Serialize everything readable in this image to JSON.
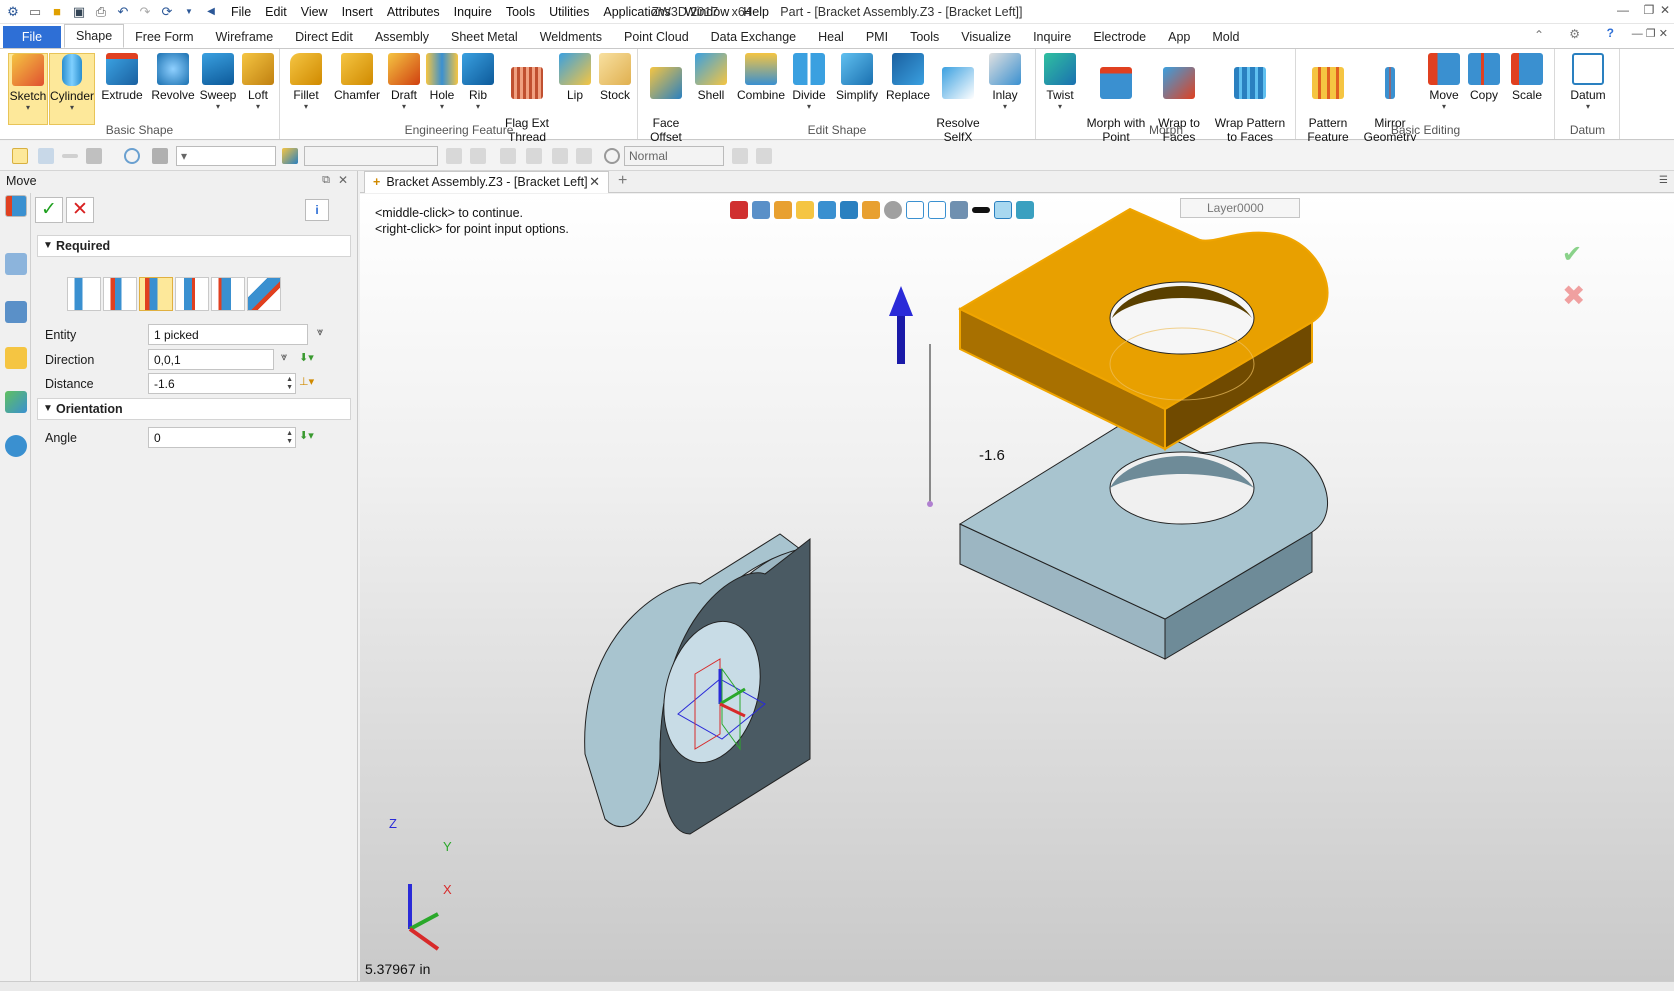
{
  "window": {
    "app_title": "ZW3D 2017",
    "arch": "x64",
    "doc_title": "Part - [Bracket Assembly.Z3 - [Bracket Left]]"
  },
  "menu": [
    "File",
    "Edit",
    "View",
    "Insert",
    "Attributes",
    "Inquire",
    "Tools",
    "Utilities",
    "Applications",
    "Window",
    "Help"
  ],
  "ribbon_tabs": [
    "File",
    "Shape",
    "Free Form",
    "Wireframe",
    "Direct Edit",
    "Assembly",
    "Sheet Metal",
    "Weldments",
    "Point Cloud",
    "Data Exchange",
    "Heal",
    "PMI",
    "Tools",
    "Visualize",
    "Inquire",
    "Electrode",
    "App",
    "Mold"
  ],
  "active_tab": "Shape",
  "ribbon": {
    "basic_shape": {
      "label": "Basic Shape",
      "buttons": [
        "Sketch",
        "Cylinder",
        "Extrude",
        "Revolve",
        "Sweep",
        "Loft"
      ]
    },
    "engineering_feature": {
      "label": "Engineering Feature",
      "buttons": [
        "Fillet",
        "Chamfer",
        "Draft",
        "Hole",
        "Rib",
        "Flag Ext\nThread",
        "Lip",
        "Stock"
      ]
    },
    "edit_shape": {
      "label": "Edit Shape",
      "buttons": [
        "Face\nOffset",
        "Shell",
        "Combine",
        "Divide",
        "Simplify",
        "Replace",
        "Resolve\nSelfX",
        "Inlay"
      ]
    },
    "morph": {
      "label": "Morph",
      "buttons": [
        "Twist",
        "Morph with\nPoint",
        "Wrap to\nFaces",
        "Wrap Pattern\nto Faces"
      ]
    },
    "basic_editing": {
      "label": "Basic Editing",
      "buttons": [
        "Pattern\nFeature",
        "Mirror\nGeometry",
        "Move",
        "Copy",
        "Scale"
      ]
    },
    "datum": {
      "label": "Datum",
      "buttons": [
        "Datum"
      ]
    }
  },
  "toolbar2": {
    "render_mode": "Normal"
  },
  "panel": {
    "title": "Move",
    "required_label": "Required",
    "entity_label": "Entity",
    "entity_value": "1 picked",
    "direction_label": "Direction",
    "direction_value": "0,0,1",
    "distance_label": "Distance",
    "distance_value": "-1.6",
    "orientation_label": "Orientation",
    "angle_label": "Angle",
    "angle_value": "0"
  },
  "doc_tab": "Bracket Assembly.Z3 - [Bracket Left]",
  "viewport": {
    "prompt_1": "<middle-click> to continue.",
    "prompt_2": "<right-click> for point input options.",
    "dimension": "-1.6",
    "coordinate": "5.37967 in",
    "layer": "Layer0000",
    "axis_labels": {
      "x": "X",
      "y": "Y",
      "z": "Z"
    }
  },
  "colors": {
    "accent": "#2e6fd6",
    "selected_part": "#f0a500",
    "part_body": "#a8c4cf",
    "part_dark": "#4a5a63"
  }
}
